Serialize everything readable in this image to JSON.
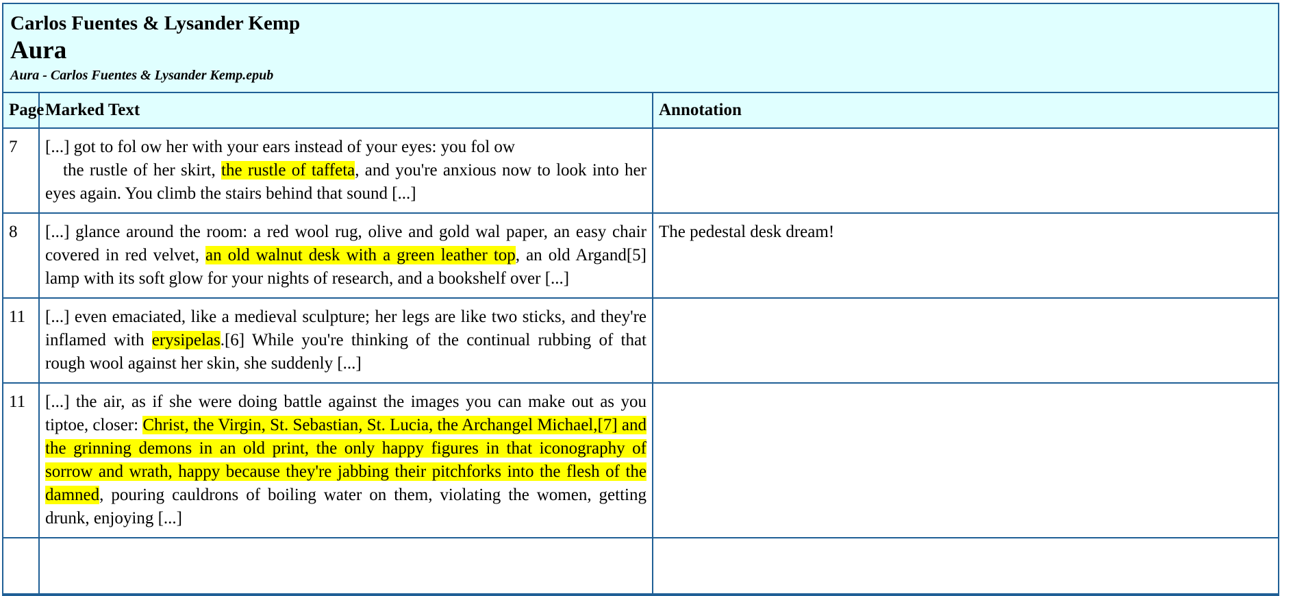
{
  "book": {
    "author": "Carlos Fuentes & Lysander Kemp",
    "title": "Aura",
    "filename": "Aura - Carlos Fuentes & Lysander Kemp.epub"
  },
  "table": {
    "headers": {
      "page": "Page",
      "marked_text": "Marked Text",
      "annotation": "Annotation"
    },
    "rows": [
      {
        "page": "7",
        "line1": "[...] got to fol ow her with your ears instead of your eyes: you fol ow",
        "before": "the rustle of her skirt, ",
        "highlight": "the rustle of taffeta",
        "after": ", and you're anxious now to look into her eyes again. You climb the stairs behind that sound [...]",
        "annotation": ""
      },
      {
        "page": "8",
        "before": "[...] glance around the room: a red wool rug, olive and gold wal paper, an easy chair covered in red velvet, ",
        "highlight": "an old walnut desk with a green leather top",
        "after": ", an old Argand[5] lamp with its soft glow for your nights of research, and a bookshelf over [...]",
        "annotation": "The pedestal desk dream!"
      },
      {
        "page": "11",
        "before": "[...] even emaciated, like a medieval sculpture; her legs are like two sticks, and they're inflamed with ",
        "highlight": "erysipelas",
        "after": ".[6] While you're thinking of the continual rubbing of that rough wool against her skin, she suddenly [...]",
        "annotation": ""
      },
      {
        "page": "11",
        "before": "[...] the air, as if she were doing battle against the images you can make out as you tiptoe, closer: ",
        "highlight": "Christ, the Virgin, St. Sebastian, St. Lucia, the Archangel Michael,[7] and the grinning demons in an old print, the only happy figures in that iconography of sorrow and wrath, happy because they're jabbing their pitchforks into the flesh of the damned",
        "after": ", pouring cauldrons of boiling water on them, violating the women, getting drunk, enjoying [...]",
        "annotation": ""
      }
    ]
  }
}
